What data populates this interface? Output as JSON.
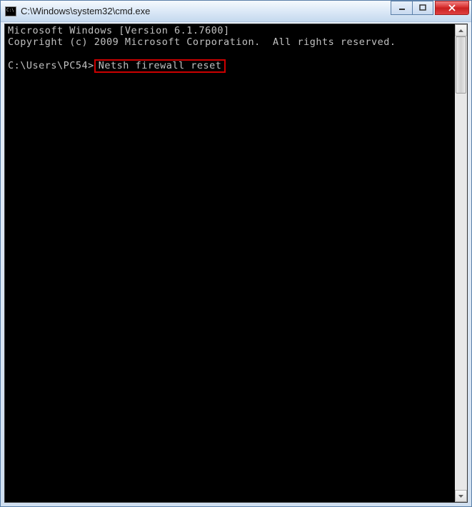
{
  "titlebar": {
    "title": "C:\\Windows\\system32\\cmd.exe"
  },
  "terminal": {
    "line1": "Microsoft Windows [Version 6.1.7600]",
    "line2": "Copyright (c) 2009 Microsoft Corporation.  All rights reserved.",
    "prompt": "C:\\Users\\PC54>",
    "command": "Netsh firewall reset"
  }
}
